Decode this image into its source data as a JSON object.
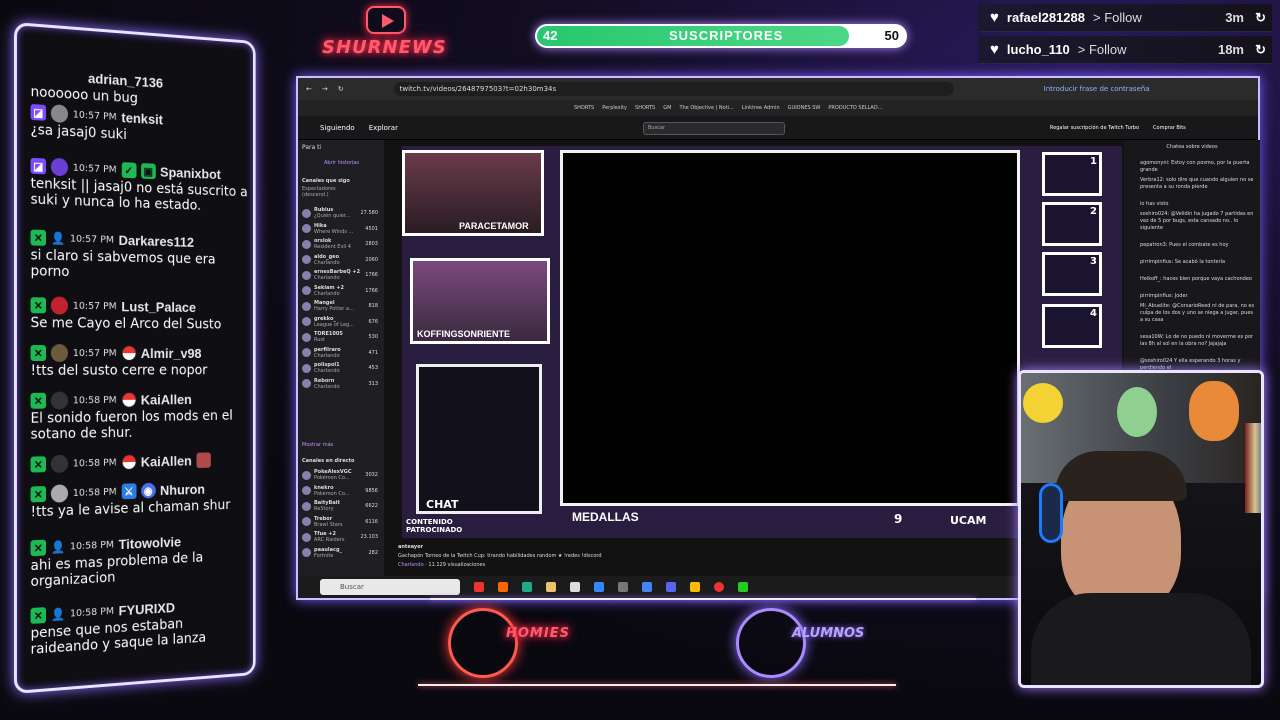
{
  "logo": {
    "text": "SHURNEWS"
  },
  "sub_goal": {
    "current": "42",
    "label": "SUSCRIPTORES",
    "target": "50",
    "progress": 0.84
  },
  "follow_alerts": [
    {
      "user": "rafael281288",
      "action": "> Follow",
      "age": "3m"
    },
    {
      "user": "lucho_110",
      "action": "> Follow",
      "age": "18m"
    }
  ],
  "chat": [
    {
      "time": "",
      "user": "adrian_7136",
      "text": "noooooo un bug"
    },
    {
      "time": "10:57 PM",
      "user": "tenksit",
      "text": "¿sa jasaj0 suki"
    },
    {
      "time": "10:57 PM",
      "user": "Spanixbot",
      "text": "tenksit || jasaj0 no está suscrito a suki y nunca lo ha estado."
    },
    {
      "time": "10:57 PM",
      "user": "Darkares112",
      "text": "si claro si sabvemos que era porno"
    },
    {
      "time": "10:57 PM",
      "user": "Lust_Palace",
      "text": "Se me Cayo el Arco del Susto"
    },
    {
      "time": "10:57 PM",
      "user": "Almir_v98",
      "text": "!tts del susto cerre e nopor"
    },
    {
      "time": "10:58 PM",
      "user": "KaiAllen",
      "text": "El sonido fueron los mods en el sotano de shur."
    },
    {
      "time": "10:58 PM",
      "user": "KaiAllen",
      "text": ""
    },
    {
      "time": "10:58 PM",
      "user": "Nhuron",
      "text": "!tts ya le avise al chaman shur"
    },
    {
      "time": "10:58 PM",
      "user": "Titowolvie",
      "text": "ahi es mas problema de la organizacion"
    },
    {
      "time": "10:58 PM",
      "user": "FYURIXD",
      "text": "pense que nos estaban raideando y saque la lanza"
    }
  ],
  "browser": {
    "url": "twitch.tv/videos/2648797503?t=02h30m34s",
    "bookmarks": [
      "SHORTS",
      "Perplexity",
      "SHORTS",
      "GM",
      "The Objective | Noti...",
      "Linktree Admin",
      "GUIONES SW",
      "PRODUCTO SELLAD..."
    ],
    "top_nav": {
      "following": "Siguiendo",
      "browse": "Explorar",
      "search_placeholder": "Buscar",
      "turbo": "Regalar suscripción de Twitch Turbo",
      "bits": "Comprar Bits"
    },
    "password_hint": "Introducir frase de contraseña",
    "sidebar": {
      "for_you": "Para ti",
      "followed_header": "Canales que sigo",
      "sort": "Espectadores (descend.)",
      "open_history": "Abrir historias",
      "show_more": "Mostrar más",
      "live_header": "Canales en directo",
      "channels": [
        {
          "name": "Rubius",
          "game": "¿Quién quier...",
          "viewers": "27.580"
        },
        {
          "name": "Hika",
          "game": "Where Winds ...",
          "viewers": "4501"
        },
        {
          "name": "orslok",
          "game": "Resident Evil 4",
          "viewers": "2803"
        },
        {
          "name": "aldo_geo",
          "game": "Charlando",
          "viewers": "2060"
        },
        {
          "name": "ernesBarbeQ +2",
          "game": "Charlando",
          "viewers": "1766"
        },
        {
          "name": "Sekiam +2",
          "game": "Charlando",
          "viewers": "1766"
        },
        {
          "name": "Mangel",
          "game": "Harry Potter a...",
          "viewers": "818"
        },
        {
          "name": "grekko_",
          "game": "League of Leg...",
          "viewers": "676"
        },
        {
          "name": "TORE1005",
          "game": "Rust",
          "viewers": "530"
        },
        {
          "name": "perfiIraro",
          "game": "Charlando",
          "viewers": "471"
        },
        {
          "name": "polispol1",
          "game": "Charlando",
          "viewers": "453"
        },
        {
          "name": "Reborn",
          "game": "Charlando",
          "viewers": "313"
        }
      ],
      "live_channels": [
        {
          "name": "PokeAlexVGC",
          "game": "Pokémon Co...",
          "viewers": "3032"
        },
        {
          "name": "knekro",
          "game": "Pokémon Co...",
          "viewers": "9856"
        },
        {
          "name": "BaityBait",
          "game": "ReStory",
          "viewers": "6622"
        },
        {
          "name": "Trebor",
          "game": "Brawl Stars",
          "viewers": "6116"
        },
        {
          "name": "Tfue +2",
          "game": "ARC Raiders",
          "viewers": "23.103"
        },
        {
          "name": "paaulacg_",
          "game": "Fortnite",
          "viewers": "282"
        }
      ]
    },
    "player": {
      "cam1_name": "PARACETAMOR",
      "cam2_name": "KOFFINGSONRIENTE",
      "chat_label": "CHAT",
      "sponsored": "CONTENIDO PATROCINADO",
      "medals": "MEDALLAS",
      "score": "9",
      "sponsor": "UCAM",
      "slots": [
        "1",
        "2",
        "3",
        "4"
      ]
    },
    "chat_header": "Chatea sobre videos",
    "chat_lines": [
      "agomonyni: Estoy con posmo, por la puerta grande",
      "Verbra12: solo dire que cuando alguien no se presenta a su ronda pierde",
      "lo has visto",
      "soshiro024: @Velidin ha jugado 7 partidas en vez de 5 por bugs, esta cansado no.. lo siguiente",
      "pepatron3: Pues el combate es hoy",
      "pirrimpinfius: Se acabó la tontería",
      "Heikoff_: haces bien porque vaya cachondeo",
      "pirrimpinfius: Joder",
      "Mi_Abuelite: @CorsarioReed ni de para, no es culpa de los dos y uno se niega a jugar, pues a su casa",
      "sesa10W: Lo de no puedo ni moverme es por las 8h al sol en la obra no? Jajajaja",
      "@soshiro024 Y ella esperando 3 horas y perdiendo el"
    ],
    "stream_meta": {
      "streamer": "anteayer",
      "title": "Gachapón Torneo de la Twitch Cup: tirando habilidades random ★ !redes !discord",
      "category": "Charlando",
      "views": "11.129 visualizaciones"
    },
    "taskbar_search": "Buscar"
  },
  "bottom_logos": {
    "left": "HOMIES",
    "right": "ALUMNOS"
  }
}
